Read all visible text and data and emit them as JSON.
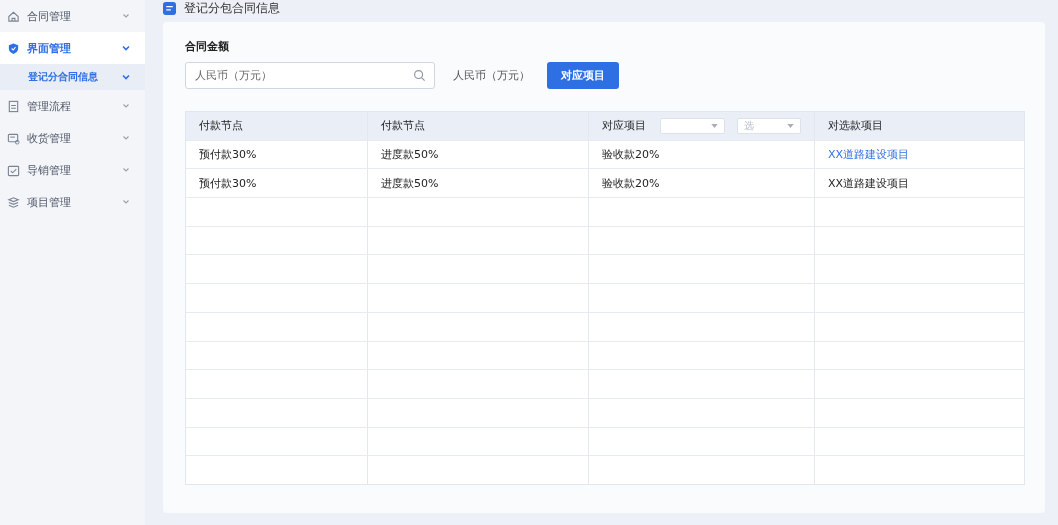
{
  "sidebar": {
    "items": [
      {
        "label": "合同管理",
        "selected": false,
        "expanded": false
      },
      {
        "label": "界面管理",
        "selected": true,
        "expanded": true,
        "children": [
          {
            "label": "登记分合同信息",
            "selected": true,
            "expanded": true
          }
        ]
      },
      {
        "label": "管理流程",
        "selected": false,
        "expanded": false
      },
      {
        "label": "收货管理",
        "selected": false,
        "expanded": false
      },
      {
        "label": "导销管理",
        "selected": false,
        "expanded": false
      },
      {
        "label": "项目管理",
        "selected": false,
        "expanded": false
      }
    ]
  },
  "page_title": "登记分包合同信息",
  "form": {
    "label": "合同金额",
    "input_placeholder": "人民币（万元）",
    "unit": "人民币（万元）",
    "button": "对应项目"
  },
  "table": {
    "columns": [
      {
        "label": "付款节点"
      },
      {
        "label": "付款节点"
      },
      {
        "label": "对应项目",
        "filters": [
          {
            "kind": "select"
          },
          {
            "kind": "select",
            "placeholder": "选"
          }
        ]
      },
      {
        "label": "对选款项目"
      }
    ],
    "rows": [
      [
        {
          "text": "预付款30%",
          "kind": "text"
        },
        {
          "text": "进度款50%",
          "kind": "text"
        },
        {
          "text": "验收款20%",
          "kind": "text"
        },
        {
          "text": "XX道路建设项目",
          "kind": "link"
        }
      ],
      [
        {
          "text": "预付款30%",
          "kind": "text"
        },
        {
          "text": "进度款50%",
          "kind": "text"
        },
        {
          "text": "验收款20%",
          "kind": "text"
        },
        {
          "text": "XX道路建设项目",
          "kind": "text"
        }
      ]
    ]
  }
}
